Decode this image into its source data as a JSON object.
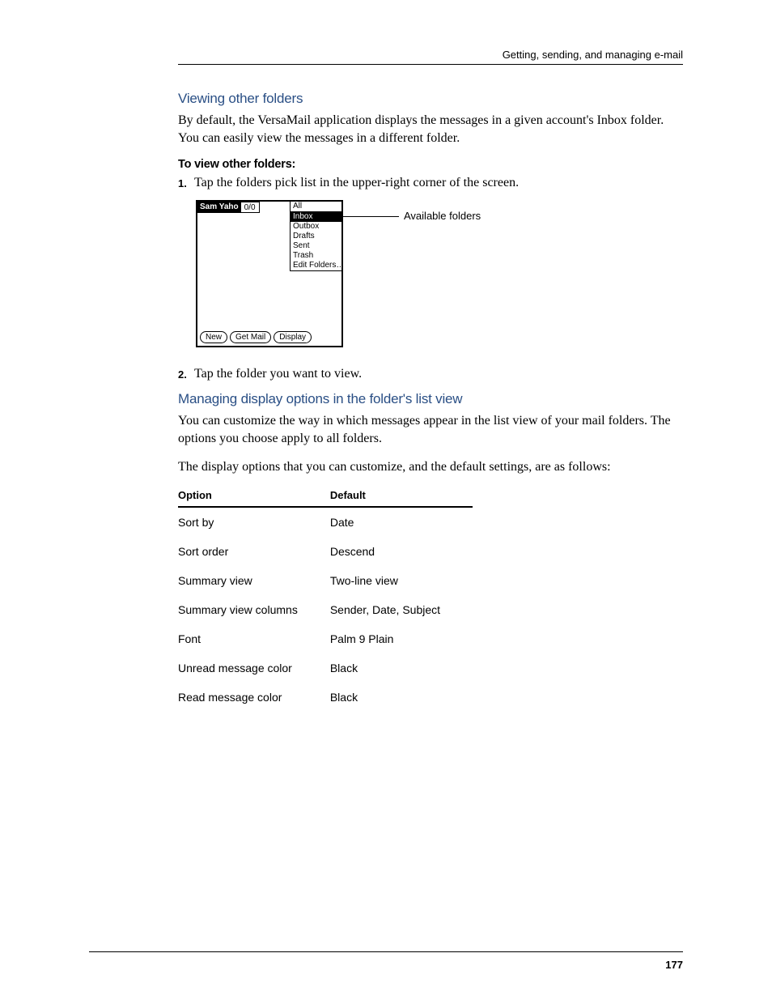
{
  "header": {
    "text": "Getting, sending, and managing e-mail"
  },
  "s1": {
    "title": "Viewing other folders",
    "p1": "By default, the VersaMail application displays the messages in a given account's Inbox folder. You can easily view the messages in a different folder.",
    "runin": "To view other folders:",
    "step1_num": "1.",
    "step1_txt": "Tap the folders pick list in the upper-right corner of the screen.",
    "fig": {
      "account": "Sam Yaho",
      "count": "0/0",
      "dd_all": "All",
      "dd_inbox": "Inbox",
      "dd_outbox": "Outbox",
      "dd_drafts": "Drafts",
      "dd_sent": "Sent",
      "dd_trash": "Trash",
      "dd_edit": "Edit Folders…",
      "btn_new": "New",
      "btn_get": "Get Mail",
      "btn_disp": "Display",
      "callout": "Available folders"
    },
    "step2_num": "2.",
    "step2_txt": "Tap the folder you want to view."
  },
  "s2": {
    "title": "Managing display options in the folder's list view",
    "p1": "You can customize the way in which messages appear in the list view of your mail folders. The options you choose apply to all folders.",
    "p2": "The display options that you can customize, and the default settings, are as follows:",
    "th1": "Option",
    "th2": "Default",
    "r1a": "Sort by",
    "r1b": "Date",
    "r2a": "Sort order",
    "r2b": "Descend",
    "r3a": "Summary view",
    "r3b": "Two-line view",
    "r4a": "Summary view columns",
    "r4b": "Sender, Date, Subject",
    "r5a": "Font",
    "r5b": "Palm 9 Plain",
    "r6a": "Unread message color",
    "r6b": "Black",
    "r7a": "Read message color",
    "r7b": "Black"
  },
  "footer": {
    "page": "177"
  }
}
